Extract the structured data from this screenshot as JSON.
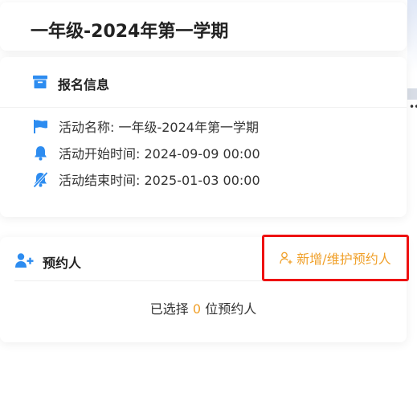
{
  "page": {
    "title": "一年级-2024年第一学期"
  },
  "registration_info": {
    "heading": "报名信息",
    "icon": "archive-box-icon",
    "activity_name": "活动名称: 一年级-2024年第一学期",
    "start_time": "活动开始时间: 2024-09-09 00:00",
    "end_time": "活动结束时间: 2025-01-03 00:00"
  },
  "reservation": {
    "heading": "预约人",
    "icon": "add-user-icon",
    "add_button_label": "新增/维护预约人",
    "selected_prefix": "已选择",
    "selected_count": "0",
    "selected_suffix": "位预约人"
  },
  "colors": {
    "accent_blue": "#2d8cf0",
    "accent_orange": "#f0a02a",
    "highlight_red": "#ee1111"
  },
  "side_strip": {
    "overflow_glyph": "••"
  }
}
